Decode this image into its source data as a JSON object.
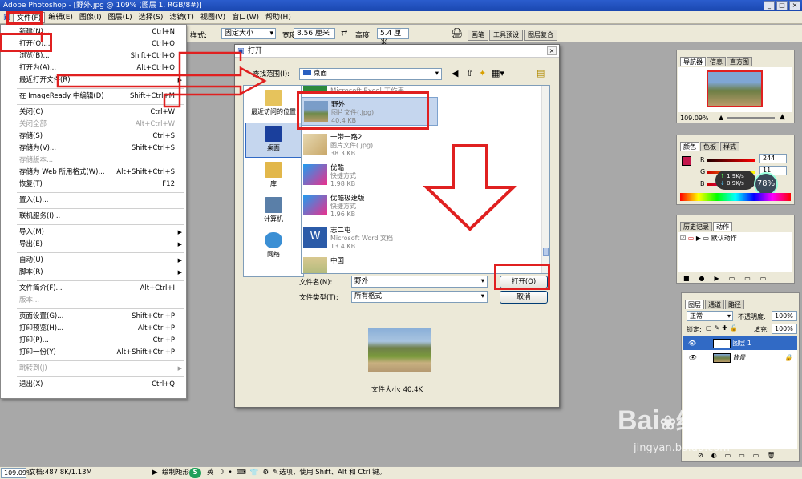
{
  "app": {
    "title": "Adobe Photoshop - [野外.jpg @ 109% (图层 1, RGB/8#)]"
  },
  "menubar": [
    "文件(F)",
    "编辑(E)",
    "图像(I)",
    "图层(L)",
    "选择(S)",
    "滤镜(T)",
    "视图(V)",
    "窗口(W)",
    "帮助(H)"
  ],
  "options": {
    "style_label": "样式:",
    "style_value": "固定大小",
    "width_label": "宽度:",
    "width_value": "8.56 厘米",
    "height_label": "高度:",
    "height_value": "5.4 厘米",
    "tabs": [
      "画笔",
      "工具预设",
      "图层复合"
    ]
  },
  "file_menu": [
    {
      "label": "新建(N)...",
      "shortcut": "Ctrl+N"
    },
    {
      "label": "打开(O)...",
      "shortcut": "Ctrl+O"
    },
    {
      "label": "浏览(B)...",
      "shortcut": "Shift+Ctrl+O"
    },
    {
      "label": "打开为(A)...",
      "shortcut": "Alt+Ctrl+O"
    },
    {
      "label": "最近打开文件(R)",
      "submenu": true
    },
    {
      "sep": true
    },
    {
      "label": "在 ImageReady 中编辑(D)",
      "shortcut": "Shift+Ctrl+M"
    },
    {
      "sep": true
    },
    {
      "label": "关闭(C)",
      "shortcut": "Ctrl+W"
    },
    {
      "label": "关闭全部",
      "shortcut": "Alt+Ctrl+W",
      "disabled": true
    },
    {
      "label": "存储(S)",
      "shortcut": "Ctrl+S"
    },
    {
      "label": "存储为(V)...",
      "shortcut": "Shift+Ctrl+S"
    },
    {
      "label": "存储版本...",
      "disabled": true
    },
    {
      "label": "存储为 Web 所用格式(W)...",
      "shortcut": "Alt+Shift+Ctrl+S"
    },
    {
      "label": "恢复(T)",
      "shortcut": "F12"
    },
    {
      "sep": true
    },
    {
      "label": "置入(L)..."
    },
    {
      "sep": true
    },
    {
      "label": "联机服务(I)..."
    },
    {
      "sep": true
    },
    {
      "label": "导入(M)",
      "submenu": true
    },
    {
      "label": "导出(E)",
      "submenu": true
    },
    {
      "sep": true
    },
    {
      "label": "自动(U)",
      "submenu": true
    },
    {
      "label": "脚本(R)",
      "submenu": true
    },
    {
      "sep": true
    },
    {
      "label": "文件简介(F)...",
      "shortcut": "Alt+Ctrl+I"
    },
    {
      "label": "版本...",
      "disabled": true
    },
    {
      "sep": true
    },
    {
      "label": "页面设置(G)...",
      "shortcut": "Shift+Ctrl+P"
    },
    {
      "label": "打印预览(H)...",
      "shortcut": "Alt+Ctrl+P"
    },
    {
      "label": "打印(P)...",
      "shortcut": "Ctrl+P"
    },
    {
      "label": "打印一份(Y)",
      "shortcut": "Alt+Shift+Ctrl+P"
    },
    {
      "sep": true
    },
    {
      "label": "跳转到(J)",
      "submenu": true,
      "disabled": true
    },
    {
      "sep": true
    },
    {
      "label": "退出(X)",
      "shortcut": "Ctrl+Q"
    }
  ],
  "dialog": {
    "title": "打开",
    "look_in_label": "查找范围(I):",
    "look_in_value": "桌面",
    "places": [
      "最近访问的位置",
      "桌面",
      "库",
      "计算机",
      "网络"
    ],
    "files": [
      {
        "name": "Microsoft Excel 工作表",
        "type": "",
        "size": ""
      },
      {
        "name": "野外",
        "type": "图片文件(.jpg)",
        "size": "40.4 KB"
      },
      {
        "name": "一带一路2",
        "type": "图片文件(.jpg)",
        "size": "38.3 KB"
      },
      {
        "name": "优酷",
        "type": "快捷方式",
        "size": "1.98 KB"
      },
      {
        "name": "优酷极速版",
        "type": "快捷方式",
        "size": "1.96 KB"
      },
      {
        "name": "志二屯",
        "type": "Microsoft Word 文档",
        "size": "13.4 KB"
      },
      {
        "name": "中国",
        "type": "",
        "size": ""
      }
    ],
    "filename_label": "文件名(N):",
    "filename_value": "野外",
    "filetype_label": "文件类型(T):",
    "filetype_value": "所有格式",
    "open_btn": "打开(O)",
    "cancel_btn": "取消",
    "preview_size": "文件大小: 40.4K"
  },
  "navigator": {
    "tabs": [
      "导航器",
      "信息",
      "直方图"
    ],
    "zoom": "109.09%"
  },
  "color": {
    "tabs": [
      "颜色",
      "色板",
      "样式"
    ],
    "R": "244",
    "G": "11",
    "B": "",
    "overlay_up": "1.9K/s",
    "overlay_down": "0.9K/s",
    "percent": "78%"
  },
  "history": {
    "tabs": [
      "历史记录",
      "动作"
    ],
    "action": "默认动作"
  },
  "layers": {
    "tabs": [
      "图层",
      "通道",
      "路径"
    ],
    "mode": "正常",
    "opacity_label": "不透明度:",
    "opacity": "100%",
    "lock_label": "锁定:",
    "fill_label": "填充:",
    "fill": "100%",
    "items": [
      "图层 1",
      "背景"
    ]
  },
  "status": {
    "zoom": "109.09%",
    "doc": "文档:487.8K/1.13M",
    "hint_pre": "绘制矩形",
    "ime": "英",
    "hint_post": "选项，使用 Shift、Alt 和 Ctrl 键。"
  },
  "watermark": {
    "brand": "Bai",
    "brand2": "经验",
    "url": "jingyan.baidu.com"
  }
}
